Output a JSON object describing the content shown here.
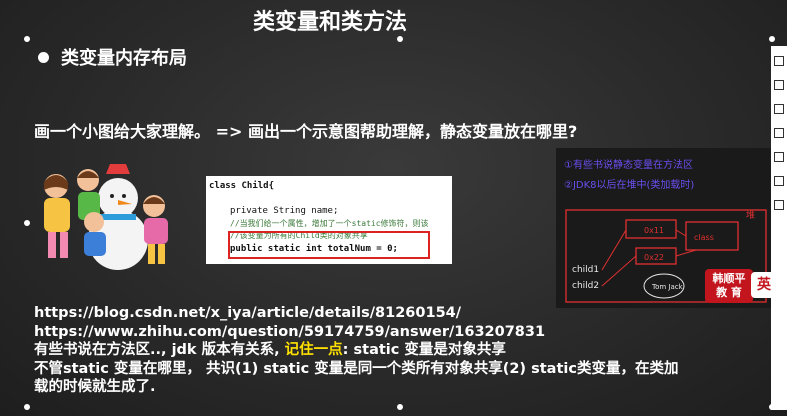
{
  "slide": {
    "title": "类变量和类方法",
    "bullet": "类变量内存布局",
    "intro": "画一个小图给大家理解。 => 画出一个示意图帮助理解，静态变量放在哪里?"
  },
  "code": {
    "line1": "class Child{",
    "line2": "private String name;",
    "line3": "//当我们给一个属性，增加了一个static修饰符，则该",
    "line4": "//该变量为所有的Child类的对象共享",
    "line5": "public static int totalNum = 0;"
  },
  "diagram": {
    "note1": "①有些书说静态变量在方法区",
    "note2": "②JDK8以后在堆中(类加载时)",
    "label_child1": "child1",
    "label_child2": "child2",
    "box1": "0x11",
    "box2": "0x22",
    "class_label": "class",
    "obj_label": "Tom Jack",
    "heap_label": "堆"
  },
  "logo": {
    "line1": "韩顺平",
    "line2": "教 育",
    "ying": "英"
  },
  "body": {
    "url1": "https://blog.csdn.net/x_iya/article/details/81260154/",
    "url2": "https://www.zhihu.com/question/59174759/answer/163207831",
    "p1_pre": "有些书说在方法区.., jdk 版本有关系, ",
    "p1_hl": "记住一点",
    "p1_post": ": static 变量是对象共享",
    "p2": "不管static 变量在哪里， 共识(1) static 变量是同一个类所有对象共享(2) static类变量，在类加",
    "p3": "载的时候就生成了."
  }
}
